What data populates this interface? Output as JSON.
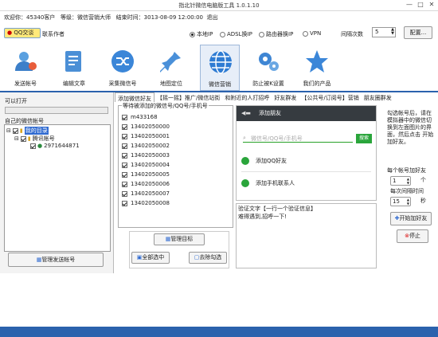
{
  "window": {
    "title": "指北针微信电脑版工具 1.0.1.10",
    "min": "—",
    "max": "□",
    "close": "✕"
  },
  "info": {
    "welcome_label": "欢迎你：",
    "user": "45340客户",
    "level_label": "等级：",
    "level": "微信营销大师",
    "expire_label": "结束时间：",
    "expire": "3013-08-09 12:00:00",
    "logout": "退出"
  },
  "qq": {
    "label": "QQ交谈",
    "contact": "联系作者"
  },
  "ip_modes": [
    {
      "label": "本地IP",
      "selected": true
    },
    {
      "label": "ADSL换IP",
      "selected": false
    },
    {
      "label": "路由器换IP",
      "selected": false
    },
    {
      "label": "VPN",
      "selected": false
    }
  ],
  "interval": {
    "label": "间隔次数",
    "value": "5"
  },
  "config_button": "配置...",
  "toolbar": [
    {
      "label": "发送帐号",
      "icon": "send-account-icon"
    },
    {
      "label": "编辑文章",
      "icon": "edit-article-icon"
    },
    {
      "label": "采集微信号",
      "icon": "collect-shuffle-icon"
    },
    {
      "label": "地图定位",
      "icon": "map-pin-icon"
    },
    {
      "label": "微信营销",
      "icon": "globe-icon"
    },
    {
      "label": "防止被K设置",
      "icon": "gears-icon"
    },
    {
      "label": "我们的产品",
      "icon": "star-icon"
    }
  ],
  "left_panel": {
    "can_open": "可以打开",
    "my_accounts": "自己的微信帐号",
    "tree": {
      "root": "我的目录",
      "child": "腾讯帐号",
      "leaf": "2971644871"
    },
    "manage_button": "管理发送帐号"
  },
  "tabs": [
    "添加微信好友",
    "【摇一摇】推广/微信站街",
    "和附近的人打招呼",
    "好友群发",
    "【公共号/订阅号】营销",
    "朋友圈群发"
  ],
  "targets": {
    "title": "等待被添加的微信号/QQ号/手机号",
    "items": [
      "m433168",
      "13402050000",
      "13402050001",
      "13402050002",
      "13402050003",
      "13402050004",
      "13402050005",
      "13402050006",
      "13402050007",
      "13402050008"
    ],
    "manage_button": "管理目标",
    "select_all": "全部选中",
    "deselect": "去除勾选"
  },
  "wechat": {
    "header": "添加朋友",
    "search_placeholder": "微信号/QQ号/手机号",
    "search_button": "搜索",
    "add_qq": "添加QQ好友",
    "add_phone": "添加手机联系人"
  },
  "verify": {
    "label": "验证文字【一行一个验证信息】",
    "text": "难得遇到,招呼一下!"
  },
  "right_panel": {
    "hint": "勾选帐号后，请在模拟器中的微信切换到左面图片的界面，然后点击 开始加好友。",
    "per_account_label": "每个帐号加好友",
    "per_account_value": "1",
    "per_account_unit": "个",
    "interval_label": "每次间隔时间",
    "interval_value": "15",
    "interval_unit": "秒",
    "start_button": "开始加好友",
    "stop_button": "停止"
  }
}
